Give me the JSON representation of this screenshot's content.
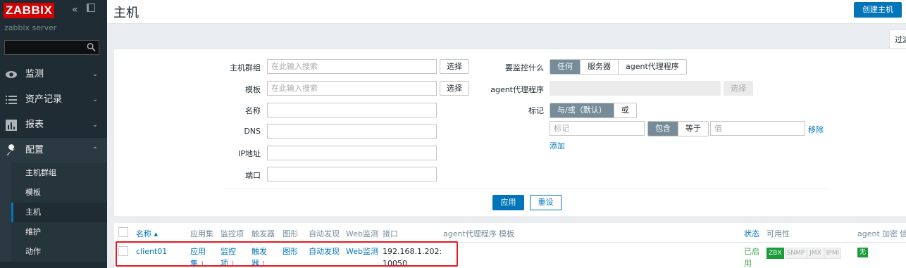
{
  "sidebar": {
    "logo": "ZABBIX",
    "server_name": "zabbix server",
    "search_placeholder": "",
    "menu": [
      {
        "label": "监测",
        "icon": "eye-icon",
        "chevron": "⌄"
      },
      {
        "label": "资产记录",
        "icon": "list-icon",
        "chevron": "⌄"
      },
      {
        "label": "报表",
        "icon": "bar-chart-icon",
        "chevron": "⌄"
      },
      {
        "label": "配置",
        "icon": "wrench-icon",
        "chevron": "⌃"
      }
    ],
    "submenu": [
      "主机群组",
      "模板",
      "主机",
      "维护",
      "动作"
    ]
  },
  "header": {
    "title": "主机",
    "create_button": "创建主机"
  },
  "filter": {
    "tab_label": "过滤器",
    "host_groups_label": "主机群组",
    "host_groups_placeholder": "在此输入搜索",
    "select_label": "选择",
    "templates_label": "模板",
    "templates_placeholder": "在此输入搜索",
    "name_label": "名称",
    "dns_label": "DNS",
    "ip_label": "IP地址",
    "port_label": "端口",
    "monitored_by_label": "要监控什么",
    "monitored_by_options": [
      "任何",
      "服务器",
      "agent代理程序"
    ],
    "proxy_label": "agent代理程序",
    "tags_label": "标记",
    "tags_mode_options": [
      "与/或（默认）",
      "或"
    ],
    "tag_placeholder": "标记",
    "tag_op_options": [
      "包含",
      "等于"
    ],
    "value_placeholder": "值",
    "remove_link": "移除",
    "add_link": "添加",
    "apply_button": "应用",
    "reset_button": "重设"
  },
  "table": {
    "headers": {
      "name": "名称 ▴",
      "applications": "应用集",
      "items": "监控项",
      "triggers": "触发器",
      "graphs": "图形",
      "discovery": "自动发现",
      "web": "Web监测",
      "interface": "接口",
      "proxy": "agent代理程序",
      "templates": "模板",
      "status": "状态",
      "availability": "可用性",
      "encryption": "agent 加密",
      "info": "信"
    },
    "rows": [
      {
        "name": "client01",
        "applications_a": "应用",
        "applications_b": "集",
        "applications_count": "1",
        "items_a": "监控",
        "items_b": "项",
        "items_count": "1",
        "triggers_a": "触发",
        "triggers_b": "器",
        "triggers_count": "1",
        "graphs": "图形",
        "discovery": "自动发现",
        "web": "Web监测",
        "interface_a": "192.168.1.202:",
        "interface_b": "10050",
        "status_a": "已启",
        "status_b": "用",
        "availability": [
          "ZBX",
          "SNMP",
          "JMX",
          "IPMI"
        ],
        "encryption": "无"
      }
    ]
  },
  "colors": {
    "sidebar_bg": "#1f2c33",
    "accent": "#0275b8",
    "logo_red": "#d40000",
    "enabled_green": "#429e47",
    "highlight_red": "#e8161c"
  }
}
